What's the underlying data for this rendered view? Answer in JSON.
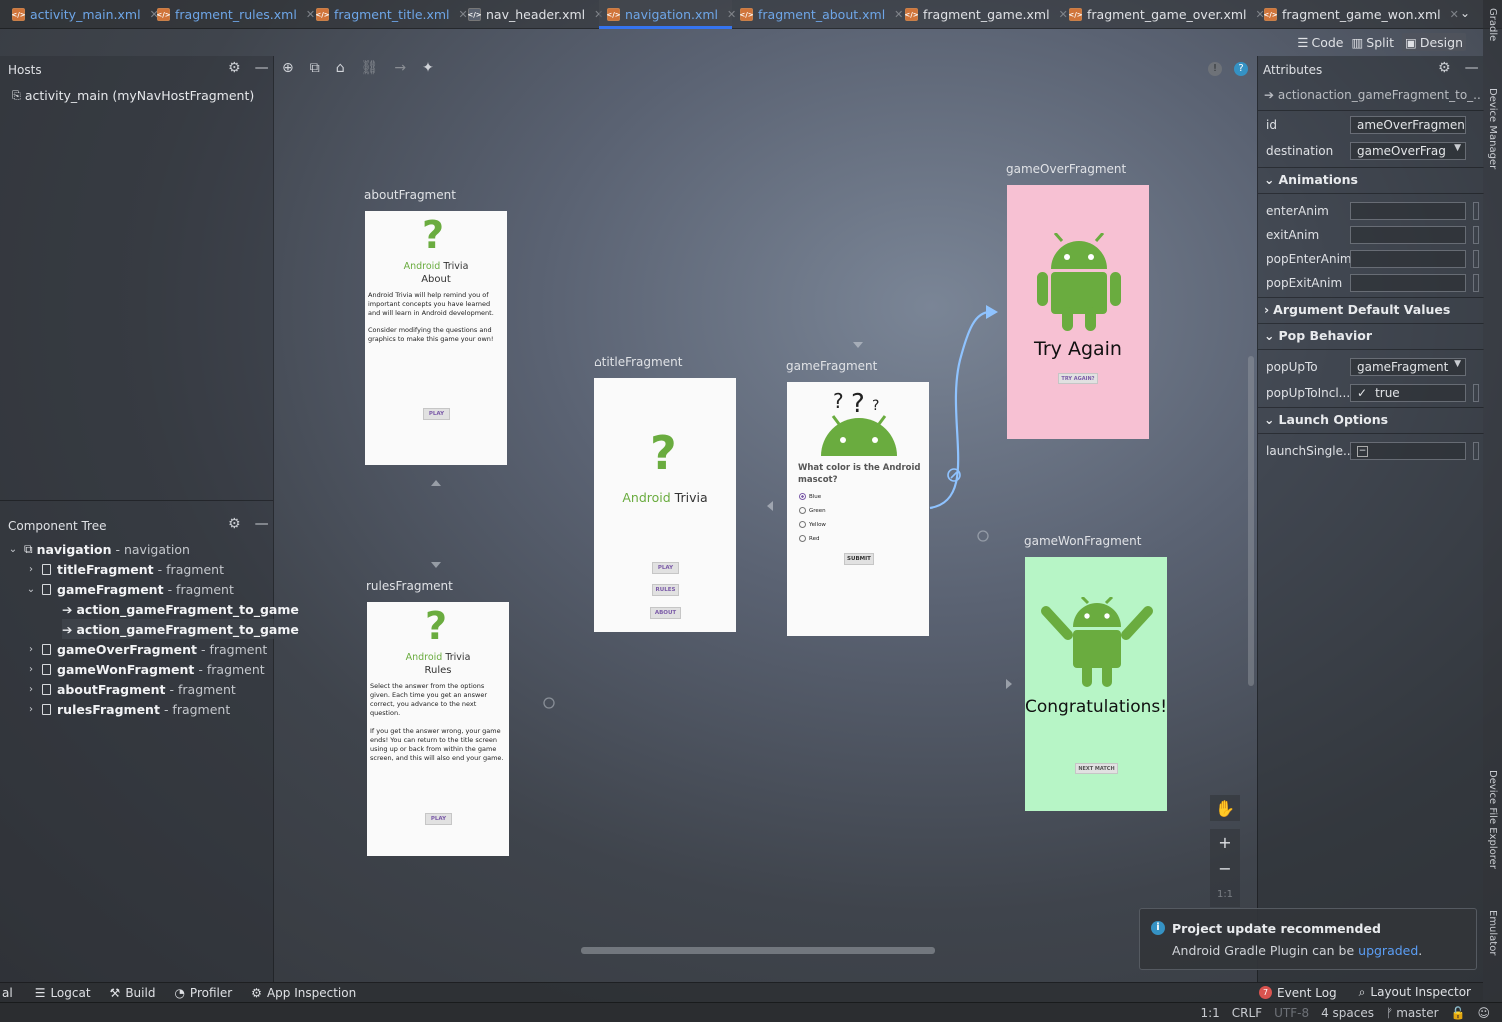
{
  "tabs": [
    {
      "label": "activity_main.xml",
      "modified": true
    },
    {
      "label": "fragment_rules.xml",
      "modified": true
    },
    {
      "label": "fragment_title.xml",
      "modified": true
    },
    {
      "label": "nav_header.xml",
      "modified": false
    },
    {
      "label": "navigation.xml",
      "modified": true,
      "active": true
    },
    {
      "label": "fragment_about.xml",
      "modified": true
    },
    {
      "label": "fragment_game.xml",
      "modified": false
    },
    {
      "label": "fragment_game_over.xml",
      "modified": false
    },
    {
      "label": "fragment_game_won.xml",
      "modified": false
    }
  ],
  "view_modes": {
    "code": "Code",
    "split": "Split",
    "design": "Design"
  },
  "hosts": {
    "title": "Hosts",
    "item": "activity_main (myNavHostFragment)"
  },
  "component_tree": {
    "title": "Component Tree",
    "rows": [
      {
        "name": "navigation",
        "type": "- navigation"
      },
      {
        "name": "titleFragment",
        "type": "- fragment"
      },
      {
        "name": "gameFragment",
        "type": "- fragment"
      },
      {
        "name": "action_gameFragment_to_game",
        "type": ""
      },
      {
        "name": "action_gameFragment_to_game",
        "type": ""
      },
      {
        "name": "gameOverFragment",
        "type": "- fragment"
      },
      {
        "name": "gameWonFragment",
        "type": "- fragment"
      },
      {
        "name": "aboutFragment",
        "type": "- fragment"
      },
      {
        "name": "rulesFragment",
        "type": "- fragment"
      }
    ]
  },
  "attributes": {
    "title": "Attributes",
    "action_header": "actionaction_gameFragment_to_...",
    "id_label": "id",
    "id_value": "ameOverFragment",
    "destination_label": "destination",
    "destination_value": "gameOverFrag",
    "animations_section": "Animations",
    "anims": [
      "enterAnim",
      "exitAnim",
      "popEnterAnim",
      "popExitAnim"
    ],
    "argument_section": "Argument Default Values",
    "pop_section": "Pop Behavior",
    "popupto_label": "popUpTo",
    "popupto_value": "gameFragment",
    "popupto_incl_label": "popUpToIncl...",
    "popupto_incl_value": "true",
    "launch_section": "Launch Options",
    "launch_single_label": "launchSingle..."
  },
  "canvas": {
    "about": {
      "label": "aboutFragment",
      "brand_green": "Android",
      "brand_dark": "Trivia",
      "subtitle": "About",
      "body1": "Android Trivia will help remind you of important concepts you have learned and will learn in Android development.",
      "body2": "Consider modifying the questions and graphics to make this game your own!",
      "button": "PLAY"
    },
    "rules": {
      "label": "rulesFragment",
      "brand_green": "Android",
      "brand_dark": "Trivia",
      "subtitle": "Rules",
      "body1": "Select the answer from the options given. Each time you get an answer correct, you advance to the next question.",
      "body2": "If you get the answer wrong, your game ends! You can return to the title screen using up or back from within the game screen, and this will also end your game.",
      "button": "PLAY"
    },
    "title": {
      "label": "titleFragment",
      "brand_green": "Android",
      "brand_dark": "Trivia",
      "buttons": [
        "PLAY",
        "RULES",
        "ABOUT"
      ]
    },
    "game": {
      "label": "gameFragment",
      "question": "What color is the Android mascot?",
      "options": [
        "Blue",
        "Green",
        "Yellow",
        "Red"
      ],
      "button": "SUBMIT"
    },
    "gameOver": {
      "label": "gameOverFragment",
      "headline": "Try Again",
      "button": "TRY AGAIN?",
      "bg": "#f7c1d3"
    },
    "gameWon": {
      "label": "gameWonFragment",
      "headline": "Congratulations!",
      "button": "NEXT MATCH",
      "bg": "#b7f5c6"
    }
  },
  "zoom": {
    "fit": "1:1"
  },
  "notification": {
    "title": "Project update recommended",
    "text": "Android Gradle Plugin can be",
    "link": "upgraded",
    "after": "."
  },
  "bottom_tools": [
    "al",
    "Logcat",
    "Build",
    "Profiler",
    "App Inspection"
  ],
  "bottom_right": {
    "event_log": "Event Log",
    "event_count": "7",
    "layout_inspector": "Layout Inspector"
  },
  "status": {
    "pos": "1:1",
    "eol": "CRLF",
    "enc": "UTF-8",
    "indent": "4 spaces",
    "branch": "master"
  },
  "side_tabs": [
    "Gradle",
    "Device Manager",
    "Device File Explorer",
    "Emulator"
  ],
  "colors": {
    "android_green": "#6aac3f",
    "accent_blue": "#3574f0",
    "link": "#5b9ef5"
  }
}
